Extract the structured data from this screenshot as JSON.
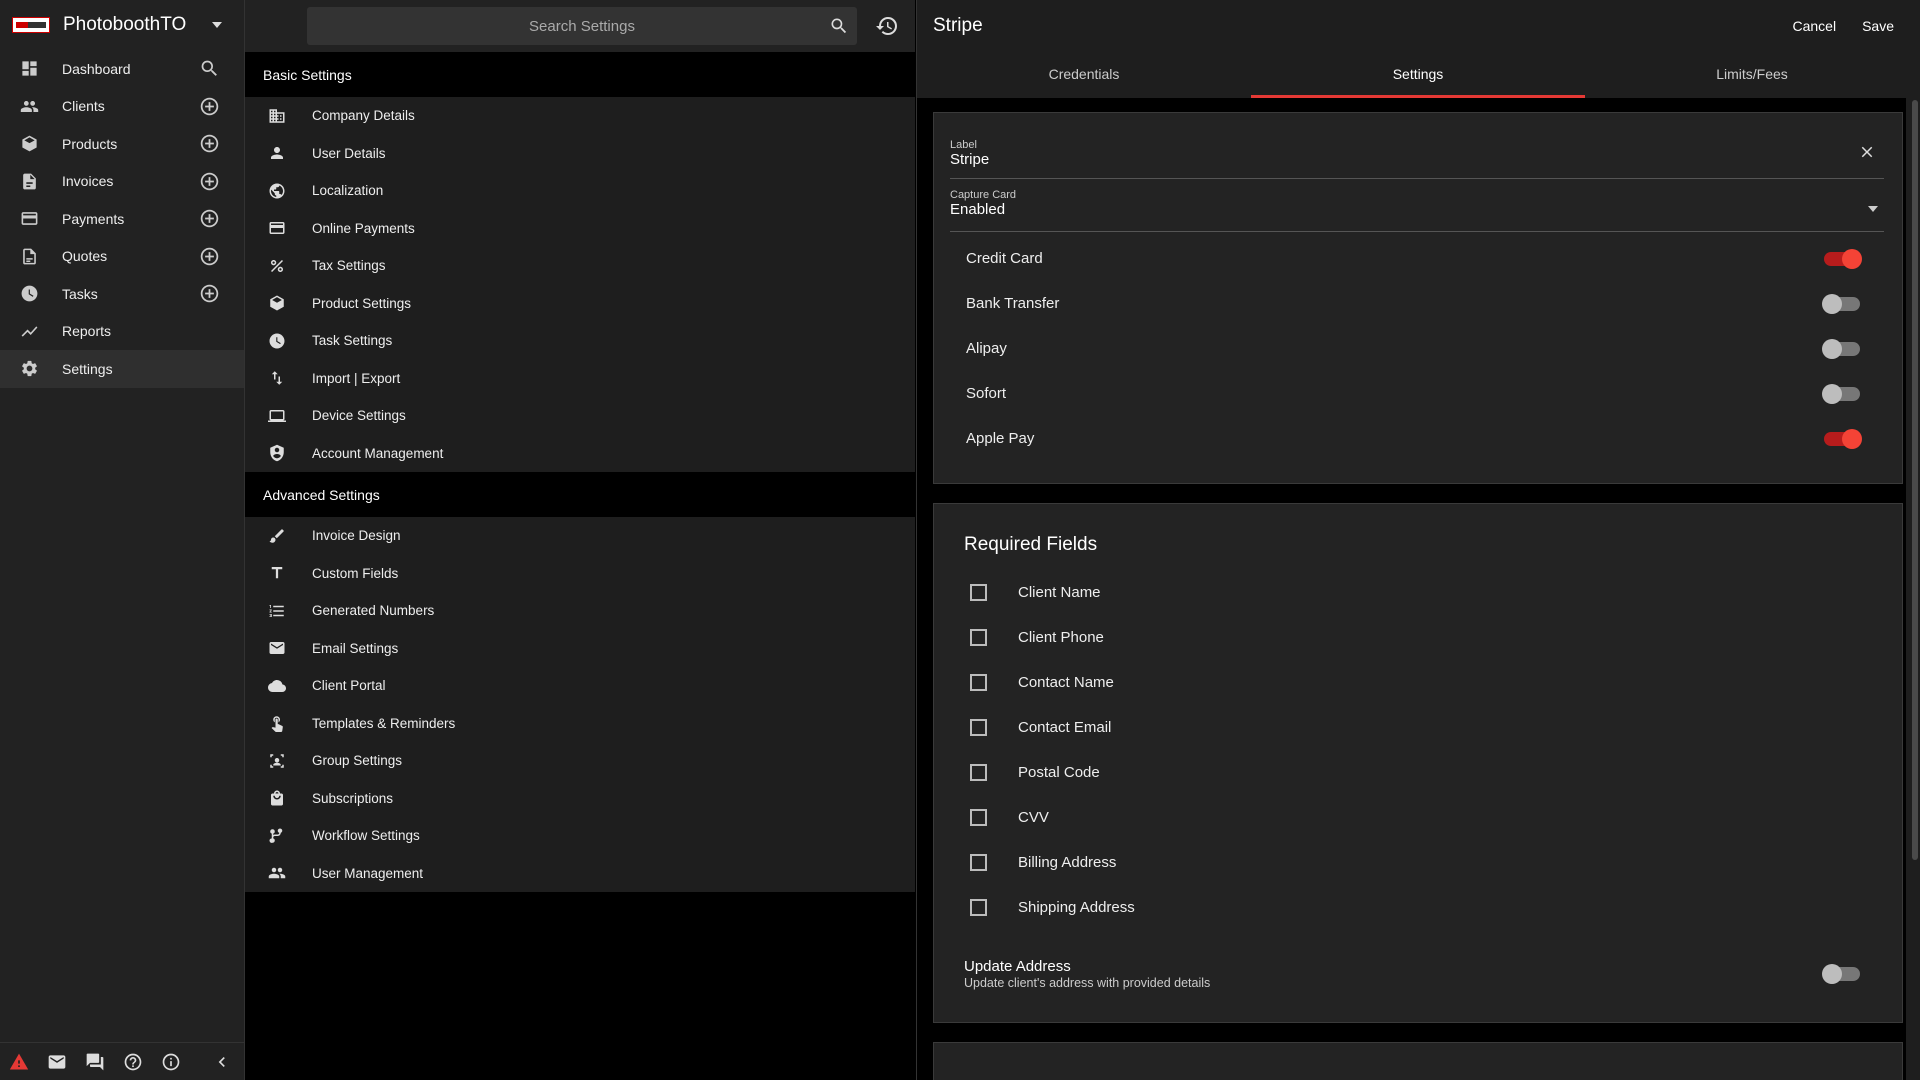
{
  "app": {
    "company": "PhotoboothTO"
  },
  "nav": {
    "items": [
      {
        "label": "Dashboard",
        "icon": "dashboard-icon",
        "action": "search-icon"
      },
      {
        "label": "Clients",
        "icon": "clients-icon",
        "action": "add-circle-icon"
      },
      {
        "label": "Products",
        "icon": "products-icon",
        "action": "add-circle-icon"
      },
      {
        "label": "Invoices",
        "icon": "invoices-icon",
        "action": "add-circle-icon"
      },
      {
        "label": "Payments",
        "icon": "payments-icon",
        "action": "add-circle-icon"
      },
      {
        "label": "Quotes",
        "icon": "quotes-icon",
        "action": "add-circle-icon"
      },
      {
        "label": "Tasks",
        "icon": "tasks-icon",
        "action": "add-circle-icon"
      },
      {
        "label": "Reports",
        "icon": "reports-icon",
        "action": ""
      },
      {
        "label": "Settings",
        "icon": "settings-icon",
        "action": "",
        "active": true
      }
    ]
  },
  "search": {
    "placeholder": "Search Settings"
  },
  "settings": {
    "basic_title": "Basic Settings",
    "basic": [
      {
        "label": "Company Details",
        "icon": "company-icon"
      },
      {
        "label": "User Details",
        "icon": "user-icon"
      },
      {
        "label": "Localization",
        "icon": "globe-icon"
      },
      {
        "label": "Online Payments",
        "icon": "credit-card-icon"
      },
      {
        "label": "Tax Settings",
        "icon": "percent-icon"
      },
      {
        "label": "Product Settings",
        "icon": "box-icon"
      },
      {
        "label": "Task Settings",
        "icon": "clock-icon"
      },
      {
        "label": "Import | Export",
        "icon": "import-export-icon"
      },
      {
        "label": "Device Settings",
        "icon": "device-icon"
      },
      {
        "label": "Account Management",
        "icon": "shield-icon"
      }
    ],
    "advanced_title": "Advanced Settings",
    "advanced": [
      {
        "label": "Invoice Design",
        "icon": "brush-icon"
      },
      {
        "label": "Custom Fields",
        "icon": "text-icon"
      },
      {
        "label": "Generated Numbers",
        "icon": "list-numbered-icon"
      },
      {
        "label": "Email Settings",
        "icon": "mail-icon"
      },
      {
        "label": "Client Portal",
        "icon": "cloud-icon"
      },
      {
        "label": "Templates & Reminders",
        "icon": "hand-icon"
      },
      {
        "label": "Group Settings",
        "icon": "group-icon"
      },
      {
        "label": "Subscriptions",
        "icon": "bag-icon"
      },
      {
        "label": "Workflow Settings",
        "icon": "branch-icon"
      },
      {
        "label": "User Management",
        "icon": "users-icon"
      }
    ]
  },
  "detail": {
    "title": "Stripe",
    "cancel_label": "Cancel",
    "save_label": "Save",
    "tabs": [
      {
        "label": "Credentials"
      },
      {
        "label": "Settings",
        "active": true
      },
      {
        "label": "Limits/Fees"
      }
    ],
    "label_field": {
      "label": "Label",
      "value": "Stripe"
    },
    "capture_field": {
      "label": "Capture Card",
      "value": "Enabled"
    },
    "toggles": [
      {
        "label": "Credit Card",
        "on": true
      },
      {
        "label": "Bank Transfer",
        "on": false
      },
      {
        "label": "Alipay",
        "on": false
      },
      {
        "label": "Sofort",
        "on": false
      },
      {
        "label": "Apple Pay",
        "on": true
      }
    ],
    "required_title": "Required Fields",
    "required": [
      {
        "label": "Client Name",
        "checked": false
      },
      {
        "label": "Client Phone",
        "checked": false
      },
      {
        "label": "Contact Name",
        "checked": false
      },
      {
        "label": "Contact Email",
        "checked": false
      },
      {
        "label": "Postal Code",
        "checked": false
      },
      {
        "label": "CVV",
        "checked": false
      },
      {
        "label": "Billing Address",
        "checked": false
      },
      {
        "label": "Shipping Address",
        "checked": false
      }
    ],
    "update_address": {
      "title": "Update Address",
      "subtitle": "Update client's address with provided details",
      "on": false
    }
  },
  "colors": {
    "accent": "#e53935",
    "toggle_on": "#f44336",
    "background": "#000000",
    "panel": "#222222"
  }
}
